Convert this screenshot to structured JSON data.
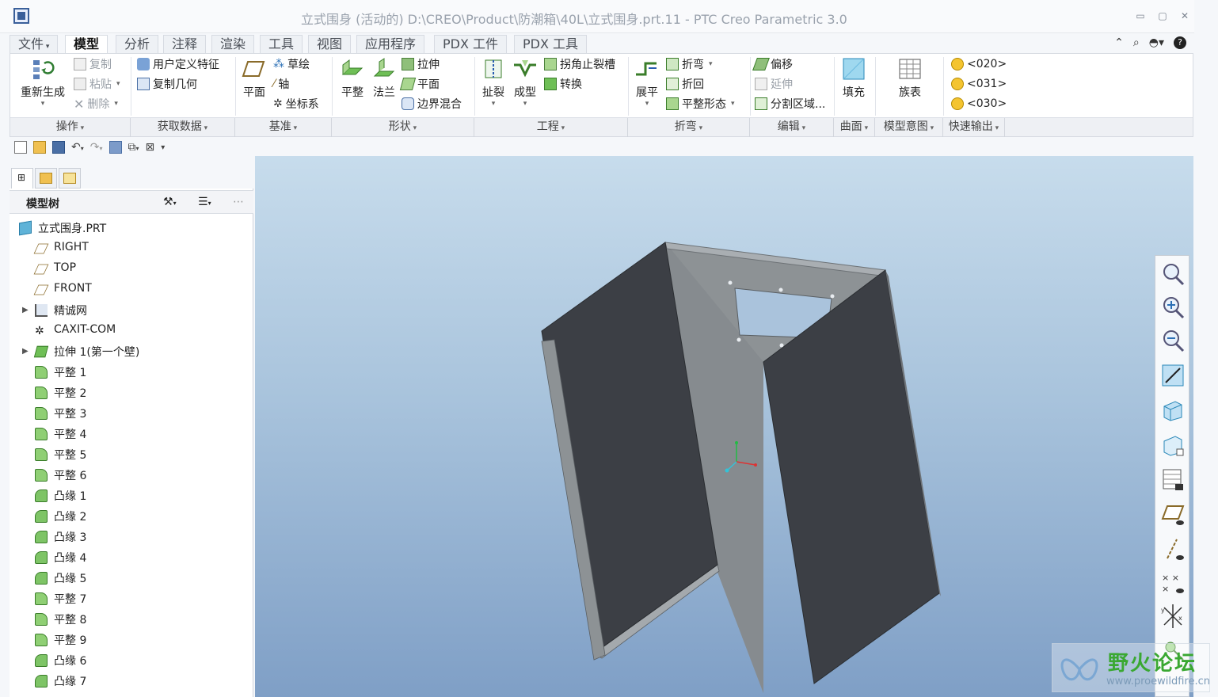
{
  "window": {
    "title": "立式围身 (活动的) D:\\CREO\\Product\\防潮箱\\40L\\立式围身.prt.11 - PTC Creo Parametric 3.0",
    "minimize": "▭",
    "restore": "▢",
    "close": "✕"
  },
  "menu": {
    "tabs": [
      "文件",
      "模型",
      "分析",
      "注释",
      "渲染",
      "工具",
      "视图",
      "应用程序",
      "PDX 工件",
      "PDX 工具"
    ],
    "active": "模型",
    "help_icons": [
      "chevron-up-icon",
      "search-icon",
      "user-icon",
      "help-icon"
    ]
  },
  "ribbon": {
    "regenerate": "重新生成",
    "copy": "复制",
    "paste": "粘贴",
    "delete": "删除",
    "user_defined_feature": "用户定义特征",
    "copy_geometry": "复制几何",
    "plane": "平面",
    "sketch": "草绘",
    "axis": "轴",
    "csys": "坐标系",
    "flat": "平整",
    "flange": "法兰",
    "extrude": "拉伸",
    "planar": "平面",
    "boundary_blend": "边界混合",
    "rip": "扯裂",
    "form": "成型",
    "corner_relief": "拐角止裂槽",
    "convert": "转换",
    "unbend": "展平",
    "bend": "折弯",
    "bend_back": "折回",
    "flat_state": "平整形态",
    "offset": "偏移",
    "extend": "延伸",
    "split_area": "分割区域...",
    "fill": "填充",
    "family_table": "族表",
    "quick_out": [
      "<020>",
      "<031>",
      "<030>"
    ],
    "groups": [
      "操作",
      "获取数据",
      "基准",
      "形状",
      "工程",
      "折弯",
      "编辑",
      "曲面",
      "模型意图",
      "快速输出"
    ]
  },
  "quick_access": [
    "new-icon",
    "open-icon",
    "save-icon",
    "undo-icon",
    "redo-icon",
    "regenerate-icon",
    "windows-icon",
    "close-window-icon",
    "customize-icon"
  ],
  "model_tree": {
    "title": "模型树",
    "root": "立式围身.PRT",
    "items": [
      {
        "label": "RIGHT",
        "icon": "datum-plane-icon",
        "expandable": false
      },
      {
        "label": "TOP",
        "icon": "datum-plane-icon",
        "expandable": false
      },
      {
        "label": "FRONT",
        "icon": "datum-plane-icon",
        "expandable": false
      },
      {
        "label": "精诚网",
        "icon": "feature-icon",
        "expandable": true
      },
      {
        "label": "CAXIT-COM",
        "icon": "csys-icon",
        "expandable": false
      },
      {
        "label": "拉伸 1(第一个壁)",
        "icon": "extrude-wall-icon",
        "expandable": true
      },
      {
        "label": "平整 1",
        "icon": "flat-wall-icon",
        "expandable": false
      },
      {
        "label": "平整 2",
        "icon": "flat-wall-icon",
        "expandable": false
      },
      {
        "label": "平整 3",
        "icon": "flat-wall-icon",
        "expandable": false
      },
      {
        "label": "平整 4",
        "icon": "flat-wall-icon",
        "expandable": false
      },
      {
        "label": "平整 5",
        "icon": "flat-wall-icon",
        "expandable": false
      },
      {
        "label": "平整 6",
        "icon": "flat-wall-icon",
        "expandable": false
      },
      {
        "label": "凸缘 1",
        "icon": "flange-wall-icon",
        "expandable": false
      },
      {
        "label": "凸缘 2",
        "icon": "flange-wall-icon",
        "expandable": false
      },
      {
        "label": "凸缘 3",
        "icon": "flange-wall-icon",
        "expandable": false
      },
      {
        "label": "凸缘 4",
        "icon": "flange-wall-icon",
        "expandable": false
      },
      {
        "label": "凸缘 5",
        "icon": "flange-wall-icon",
        "expandable": false
      },
      {
        "label": "平整 7",
        "icon": "flat-wall-icon",
        "expandable": false
      },
      {
        "label": "平整 8",
        "icon": "flat-wall-icon",
        "expandable": false
      },
      {
        "label": "平整 9",
        "icon": "flat-wall-icon",
        "expandable": false
      },
      {
        "label": "凸缘 6",
        "icon": "flange-wall-icon",
        "expandable": false
      },
      {
        "label": "凸缘 7",
        "icon": "flange-wall-icon",
        "expandable": false
      }
    ]
  },
  "view_toolbar": [
    "refit-icon",
    "zoom-in-icon",
    "zoom-out-icon",
    "repaint-icon",
    "display-style-icon",
    "saved-views-icon",
    "view-manager-icon",
    "plane-display-icon",
    "axis-display-icon",
    "point-display-icon",
    "csys-display-icon",
    "annotation-display-icon"
  ],
  "colors": {
    "accent": "#3a5f9a",
    "sheet_dark": "#3c3f45",
    "sheet_mid": "#8f9497",
    "viewport_top": "#c7dcec",
    "viewport_bottom": "#7f9fc6"
  },
  "watermark": {
    "text": "野火论坛",
    "url": "www.proewildfire.cn"
  }
}
